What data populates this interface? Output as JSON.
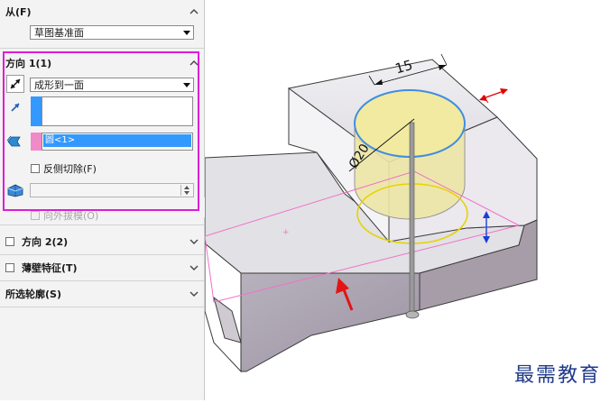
{
  "panel": {
    "from": {
      "header": "从(F)",
      "selected": "草图基准面"
    },
    "direction1": {
      "header": "方向 1(1)",
      "end_condition": "成形到一面",
      "face_value": "",
      "contour_value": "圆<1>",
      "reverse_cut_label": "反侧切除(F)",
      "draft_value": "",
      "draft_outward_label": "向外拔模(O)"
    },
    "direction2": {
      "header": "方向 2(2)"
    },
    "thin_feature": {
      "header": "薄壁特征(T)"
    },
    "selected_contours": {
      "header": "所选轮廓(S)"
    }
  },
  "viewport": {
    "dim_length": "15",
    "dim_diameter": "Ø20"
  },
  "watermark": "最需教育",
  "colors": {
    "highlight_magenta": "#e11bd8",
    "selection_blue": "#3399ff",
    "face_pink": "#f08ac8",
    "cylinder_yellow": "#efe7a5",
    "circle_yellow": "#e6d400"
  }
}
